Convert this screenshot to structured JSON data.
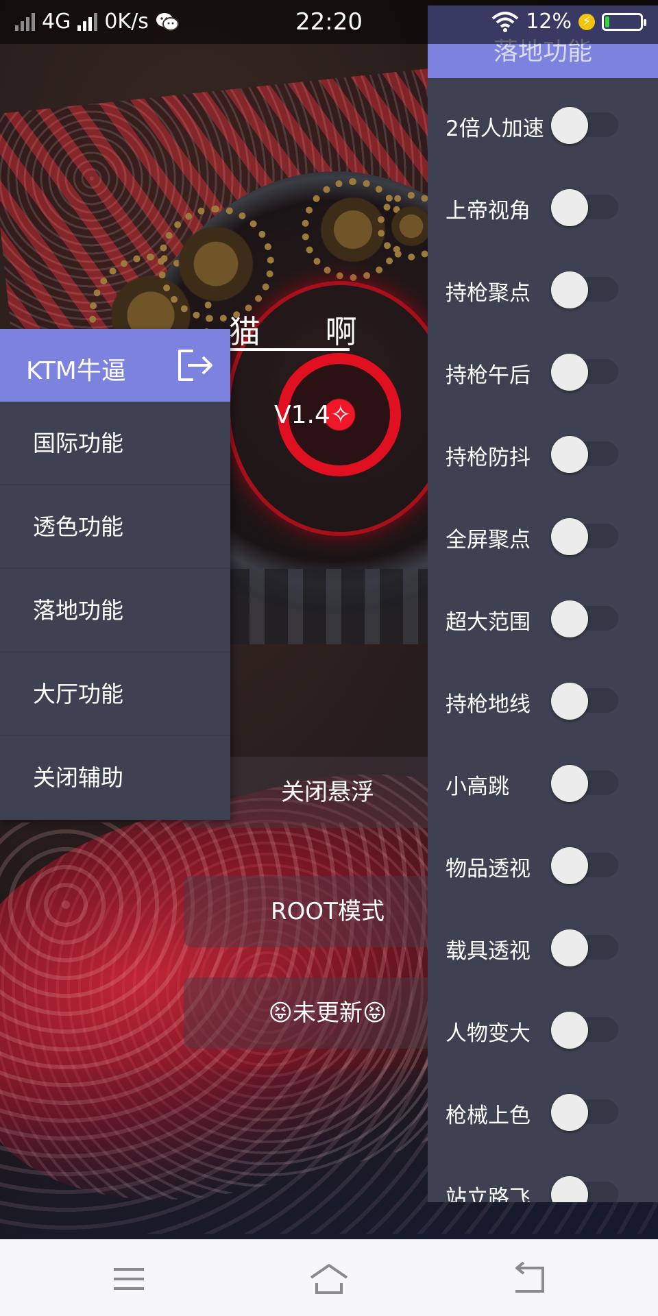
{
  "status_bar": {
    "network": "4G",
    "speed": "0K/s",
    "time": "22:20",
    "battery_percent": "12%",
    "battery_level": 0.12,
    "icons": [
      "signal-icon",
      "wechat-icon",
      "wifi-icon",
      "charging-icon",
      "battery-icon"
    ]
  },
  "overlay": {
    "title": "猫 啊",
    "version": "V1.4✧",
    "buttons": [
      "关闭悬浮",
      "ROOT模式",
      "😝未更新😝"
    ]
  },
  "left_menu": {
    "header": "KTM牛逼",
    "exit_icon": "logout-icon",
    "items": [
      "国际功能",
      "透色功能",
      "落地功能",
      "大厅功能",
      "关闭辅助"
    ]
  },
  "right_panel": {
    "title": "落地功能",
    "features": [
      {
        "label": "2倍人加速",
        "on": false
      },
      {
        "label": "上帝视角",
        "on": false
      },
      {
        "label": "持枪聚点",
        "on": false
      },
      {
        "label": "持枪午后",
        "on": false
      },
      {
        "label": "持枪防抖",
        "on": false
      },
      {
        "label": "全屏聚点",
        "on": false
      },
      {
        "label": "超大范围",
        "on": false
      },
      {
        "label": "持枪地线",
        "on": false
      },
      {
        "label": "小高跳",
        "on": false
      },
      {
        "label": "物品透视",
        "on": false
      },
      {
        "label": "载具透视",
        "on": false
      },
      {
        "label": "人物变大",
        "on": false
      },
      {
        "label": "枪械上色",
        "on": false
      },
      {
        "label": "站立路飞",
        "on": false
      }
    ]
  },
  "nav_bar": {
    "icons": [
      "menu-icon",
      "home-icon",
      "back-icon"
    ]
  },
  "colors": {
    "accent": "#7c82dd",
    "panel": "#3e4151",
    "switch_knob": "#ececec",
    "battery": "#38d33f"
  }
}
